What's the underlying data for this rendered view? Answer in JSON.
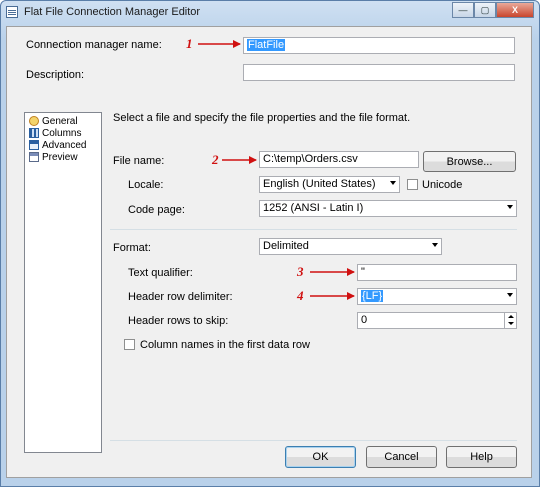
{
  "window": {
    "title": "Flat File Connection Manager Editor",
    "buttons": {
      "minimize": "—",
      "maximize": "▢",
      "close": "X"
    }
  },
  "connection_name": {
    "label": "Connection manager name:",
    "value": "FlatFile"
  },
  "description": {
    "label": "Description:",
    "value": ""
  },
  "nav": {
    "items": [
      {
        "label": "General",
        "icon": "general-icon"
      },
      {
        "label": "Columns",
        "icon": "columns-icon"
      },
      {
        "label": "Advanced",
        "icon": "advanced-icon"
      },
      {
        "label": "Preview",
        "icon": "preview-icon"
      }
    ]
  },
  "instructions": "Select a file and specify the file properties and the file format.",
  "file": {
    "label": "File name:",
    "value": "C:\\temp\\Orders.csv",
    "browse_label": "Browse..."
  },
  "locale": {
    "label": "Locale:",
    "value": "English (United States)",
    "unicode_label": "Unicode"
  },
  "codepage": {
    "label": "Code page:",
    "value": "1252  (ANSI - Latin I)"
  },
  "format": {
    "label": "Format:",
    "value": "Delimited"
  },
  "text_qualifier": {
    "label": "Text qualifier:",
    "value": "\""
  },
  "header_row_delimiter": {
    "label": "Header row delimiter:",
    "value": "{LF}"
  },
  "header_rows_skip": {
    "label": "Header rows to skip:",
    "value": "0"
  },
  "column_names": {
    "label": "Column names in the first data row"
  },
  "buttons": {
    "ok": "OK",
    "cancel": "Cancel",
    "help": "Help"
  },
  "annotations": [
    "1",
    "2",
    "3",
    "4"
  ],
  "colors": {
    "annotation": "#d01010",
    "selection": "#3399ff"
  }
}
